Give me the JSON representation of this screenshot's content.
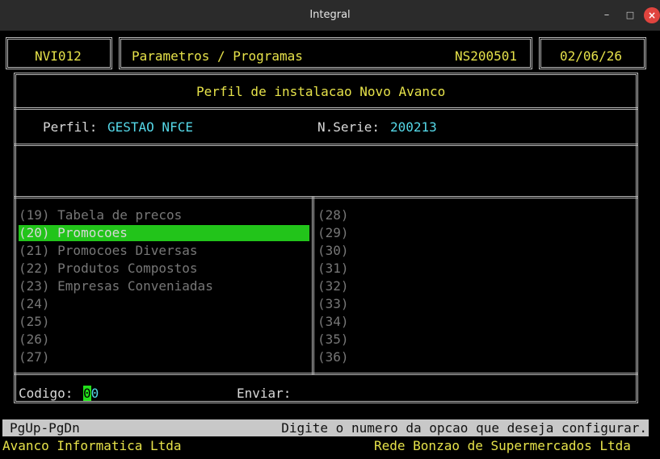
{
  "window": {
    "title": "Integral"
  },
  "header": {
    "program_code": "NVI012",
    "module_title": "Parametros / Programas",
    "serial_code": "NS200501",
    "date": "02/06/26"
  },
  "panel": {
    "title": "Perfil de instalacao Novo Avanco",
    "perfil_label": "Perfil:",
    "perfil_value": "GESTAO NFCE",
    "serie_label": "N.Serie:",
    "serie_value": "200213"
  },
  "options_left": [
    {
      "label": "(19) Tabela de precos",
      "selected": false
    },
    {
      "label": "(20) Promocoes",
      "selected": true
    },
    {
      "label": "(21) Promocoes Diversas",
      "selected": false
    },
    {
      "label": "(22) Produtos Compostos",
      "selected": false
    },
    {
      "label": "(23) Empresas Conveniadas",
      "selected": false
    },
    {
      "label": "(24)",
      "selected": false
    },
    {
      "label": "(25)",
      "selected": false
    },
    {
      "label": "(26)",
      "selected": false
    },
    {
      "label": "(27)",
      "selected": false
    }
  ],
  "options_right": [
    "(28)",
    "(29)",
    "(30)",
    "(31)",
    "(32)",
    "(33)",
    "(34)",
    "(35)",
    "(36)"
  ],
  "input": {
    "codigo_label": "Codigo:",
    "codigo_cursor": "0",
    "codigo_value": "0",
    "enviar_label": "Enviar:"
  },
  "statusbar": {
    "keys": "PgUp-PgDn",
    "hint": "Digite o numero da opcao que deseja configurar."
  },
  "footer": {
    "left": "Avanco Informatica Ltda",
    "right": "Rede Bonzao de Supermercados Ltda"
  }
}
